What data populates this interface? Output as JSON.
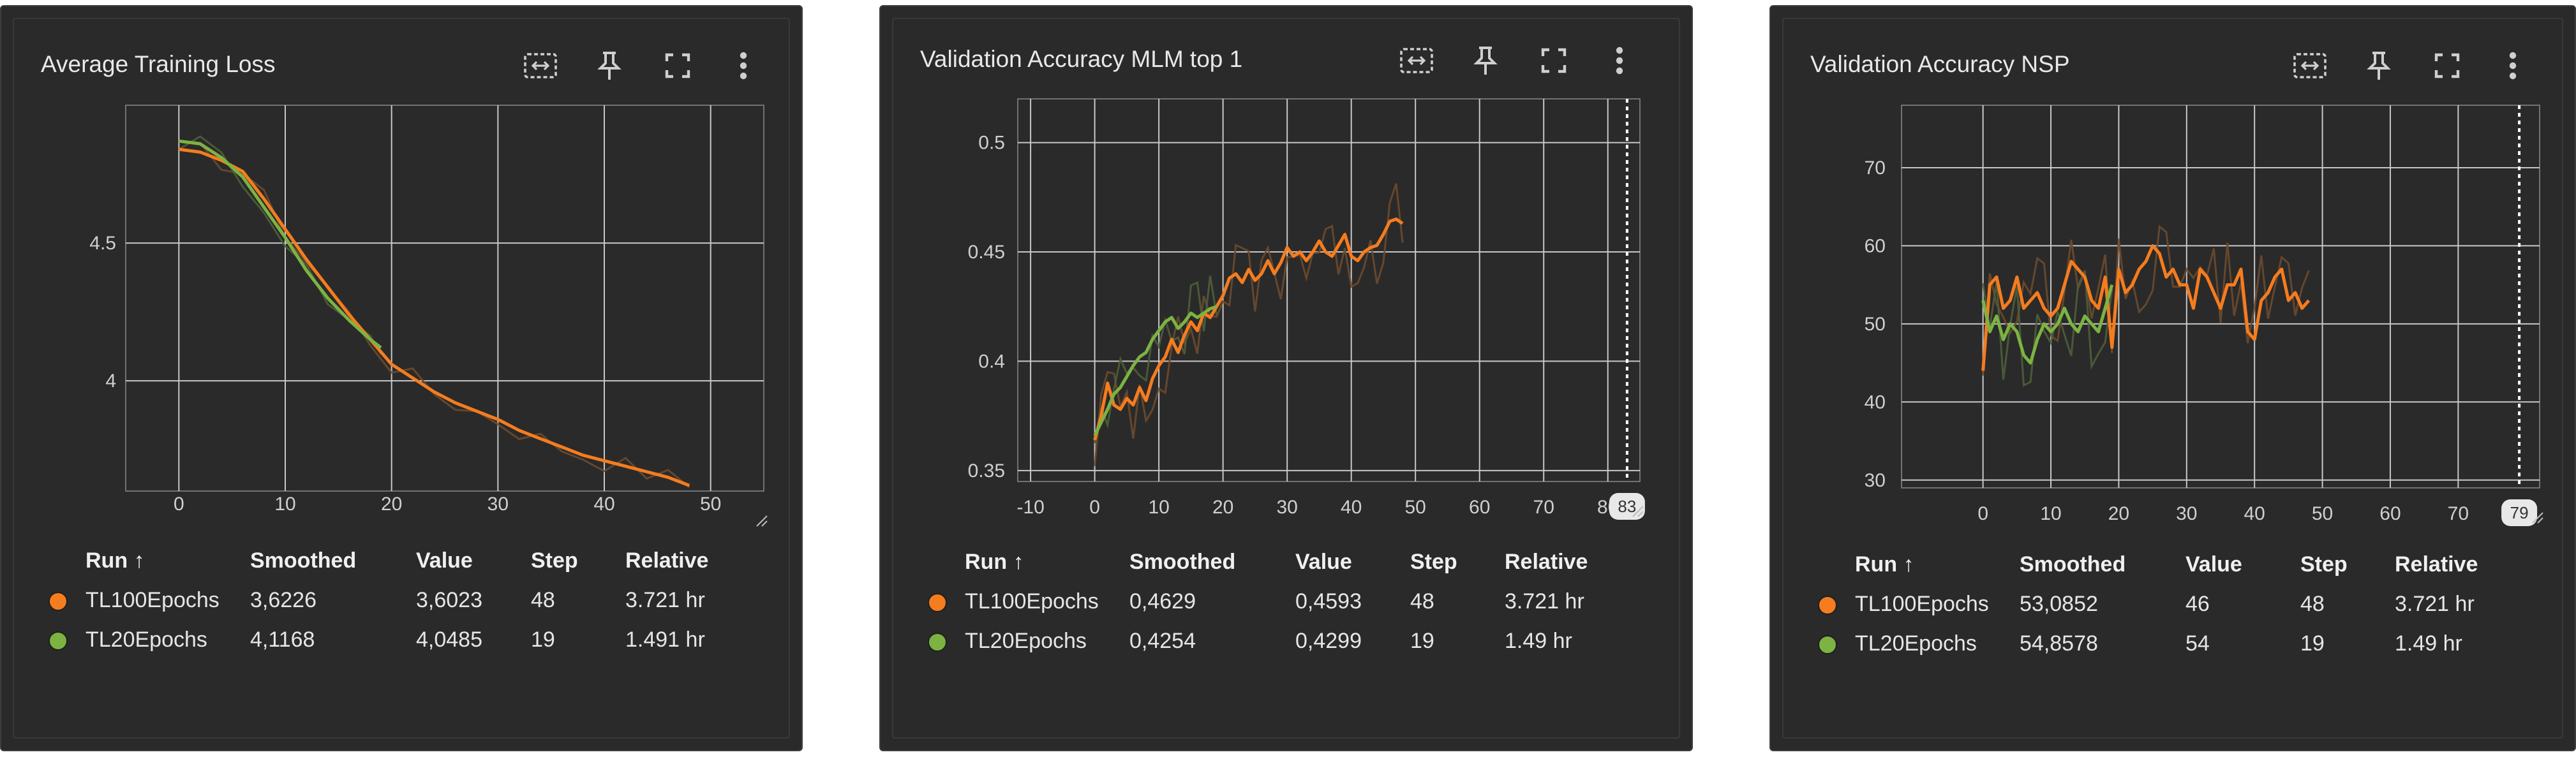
{
  "colors": {
    "run1": "#f57c1f",
    "run2": "#7cb342",
    "card_bg": "#2a2a2a",
    "grid": "#c8c8c8",
    "raw_line": "#6b4a2e"
  },
  "toolbar_icons": [
    "fit-domain-icon",
    "pin-icon",
    "fullscreen-icon",
    "more-vert-icon"
  ],
  "legend_headers": {
    "run": "Run ↑",
    "smoothed": "Smoothed",
    "value": "Value",
    "step": "Step",
    "relative": "Relative"
  },
  "cards": [
    {
      "title": "Average Training Loss",
      "rows": [
        {
          "run": "TL100Epochs",
          "smoothed": "3,6226",
          "value": "3,6023",
          "step": "48",
          "relative": "3.721 hr"
        },
        {
          "run": "TL20Epochs",
          "smoothed": "4,1168",
          "value": "4,0485",
          "step": "19",
          "relative": "1.491 hr"
        }
      ]
    },
    {
      "title": "Validation Accuracy MLM top 1",
      "rows": [
        {
          "run": "TL100Epochs",
          "smoothed": "0,4629",
          "value": "0,4593",
          "step": "48",
          "relative": "3.721 hr"
        },
        {
          "run": "TL20Epochs",
          "smoothed": "0,4254",
          "value": "0,4299",
          "step": "19",
          "relative": "1.49 hr"
        }
      ]
    },
    {
      "title": "Validation Accuracy NSP",
      "rows": [
        {
          "run": "TL100Epochs",
          "smoothed": "53,0852",
          "value": "46",
          "step": "48",
          "relative": "3.721 hr"
        },
        {
          "run": "TL20Epochs",
          "smoothed": "54,8578",
          "value": "54",
          "step": "19",
          "relative": "1.49 hr"
        }
      ]
    }
  ],
  "chart_data": [
    {
      "type": "line",
      "title": "Average Training Loss",
      "xlim": [
        -5,
        55
      ],
      "ylim": [
        3.6,
        5.0
      ],
      "x_ticks": [
        0,
        10,
        20,
        30,
        40,
        50
      ],
      "y_ticks": [
        4,
        4.5
      ],
      "grid": true,
      "series": [
        {
          "name": "TL100Epochs",
          "x": [
            0,
            2,
            4,
            6,
            8,
            10,
            12,
            14,
            16,
            18,
            20,
            22,
            24,
            26,
            28,
            30,
            32,
            34,
            36,
            38,
            40,
            42,
            44,
            46,
            48
          ],
          "y": [
            4.84,
            4.83,
            4.8,
            4.76,
            4.66,
            4.55,
            4.44,
            4.34,
            4.24,
            4.15,
            4.06,
            4.01,
            3.96,
            3.92,
            3.89,
            3.86,
            3.82,
            3.79,
            3.76,
            3.73,
            3.71,
            3.69,
            3.67,
            3.65,
            3.62
          ]
        },
        {
          "name": "TL20Epochs",
          "x": [
            0,
            2,
            4,
            6,
            8,
            10,
            12,
            14,
            16,
            18,
            19
          ],
          "y": [
            4.87,
            4.86,
            4.81,
            4.74,
            4.63,
            4.52,
            4.4,
            4.3,
            4.22,
            4.15,
            4.12
          ]
        }
      ]
    },
    {
      "type": "line",
      "title": "Validation Accuracy MLM top 1",
      "xlim": [
        -12,
        85
      ],
      "ylim": [
        0.345,
        0.52
      ],
      "x_ticks": [
        -10,
        0,
        10,
        20,
        30,
        40,
        50,
        60,
        70,
        80
      ],
      "y_ticks": [
        0.35,
        0.4,
        0.45,
        0.5
      ],
      "grid": true,
      "marker_x": 83,
      "series": [
        {
          "name": "TL100Epochs",
          "x": [
            0,
            1,
            2,
            3,
            4,
            5,
            6,
            7,
            8,
            9,
            10,
            11,
            12,
            13,
            14,
            15,
            16,
            17,
            18,
            19,
            20,
            21,
            22,
            23,
            24,
            25,
            26,
            27,
            28,
            29,
            30,
            31,
            32,
            33,
            34,
            35,
            36,
            37,
            38,
            39,
            40,
            41,
            42,
            43,
            44,
            45,
            46,
            47,
            48
          ],
          "y": [
            0.364,
            0.375,
            0.39,
            0.38,
            0.378,
            0.383,
            0.38,
            0.388,
            0.382,
            0.392,
            0.398,
            0.402,
            0.41,
            0.404,
            0.412,
            0.418,
            0.414,
            0.422,
            0.42,
            0.425,
            0.43,
            0.438,
            0.44,
            0.436,
            0.442,
            0.437,
            0.44,
            0.446,
            0.44,
            0.445,
            0.452,
            0.448,
            0.45,
            0.446,
            0.45,
            0.455,
            0.45,
            0.448,
            0.453,
            0.458,
            0.448,
            0.446,
            0.45,
            0.452,
            0.453,
            0.458,
            0.464,
            0.465,
            0.463
          ]
        },
        {
          "name": "TL20Epochs",
          "x": [
            0,
            1,
            2,
            3,
            4,
            5,
            6,
            7,
            8,
            9,
            10,
            11,
            12,
            13,
            14,
            15,
            16,
            17,
            18,
            19
          ],
          "y": [
            0.366,
            0.372,
            0.378,
            0.385,
            0.388,
            0.393,
            0.398,
            0.402,
            0.404,
            0.41,
            0.414,
            0.418,
            0.42,
            0.415,
            0.418,
            0.422,
            0.42,
            0.422,
            0.424,
            0.425
          ]
        }
      ]
    },
    {
      "type": "line",
      "title": "Validation Accuracy NSP",
      "xlim": [
        -12,
        82
      ],
      "ylim": [
        29,
        78
      ],
      "x_ticks": [
        0,
        10,
        20,
        30,
        40,
        50,
        60,
        70
      ],
      "y_ticks": [
        30,
        40,
        50,
        60,
        70
      ],
      "grid": true,
      "marker_x": 79,
      "series": [
        {
          "name": "TL100Epochs",
          "x": [
            0,
            1,
            2,
            3,
            4,
            5,
            6,
            7,
            8,
            9,
            10,
            11,
            12,
            13,
            14,
            15,
            16,
            17,
            18,
            19,
            20,
            21,
            22,
            23,
            24,
            25,
            26,
            27,
            28,
            29,
            30,
            31,
            32,
            33,
            34,
            35,
            36,
            37,
            38,
            39,
            40,
            41,
            42,
            43,
            44,
            45,
            46,
            47,
            48
          ],
          "y": [
            44,
            55,
            56,
            52,
            53,
            56,
            52,
            53,
            54,
            52,
            51,
            52,
            55,
            58,
            57,
            56,
            53,
            52,
            56,
            47,
            57,
            54,
            55,
            57,
            58,
            60,
            59,
            56,
            57,
            55,
            55,
            52,
            57,
            56,
            54,
            52,
            55,
            55,
            57,
            49,
            48,
            53,
            54,
            56,
            57,
            53,
            54,
            52,
            53
          ]
        },
        {
          "name": "TL20Epochs",
          "x": [
            0,
            1,
            2,
            3,
            4,
            5,
            6,
            7,
            8,
            9,
            10,
            11,
            12,
            13,
            14,
            15,
            16,
            17,
            18,
            19
          ],
          "y": [
            53,
            49,
            51,
            48,
            50,
            49,
            46,
            45,
            48,
            50,
            49,
            50,
            52,
            50,
            49,
            51,
            50,
            49,
            52,
            55
          ]
        }
      ]
    }
  ]
}
